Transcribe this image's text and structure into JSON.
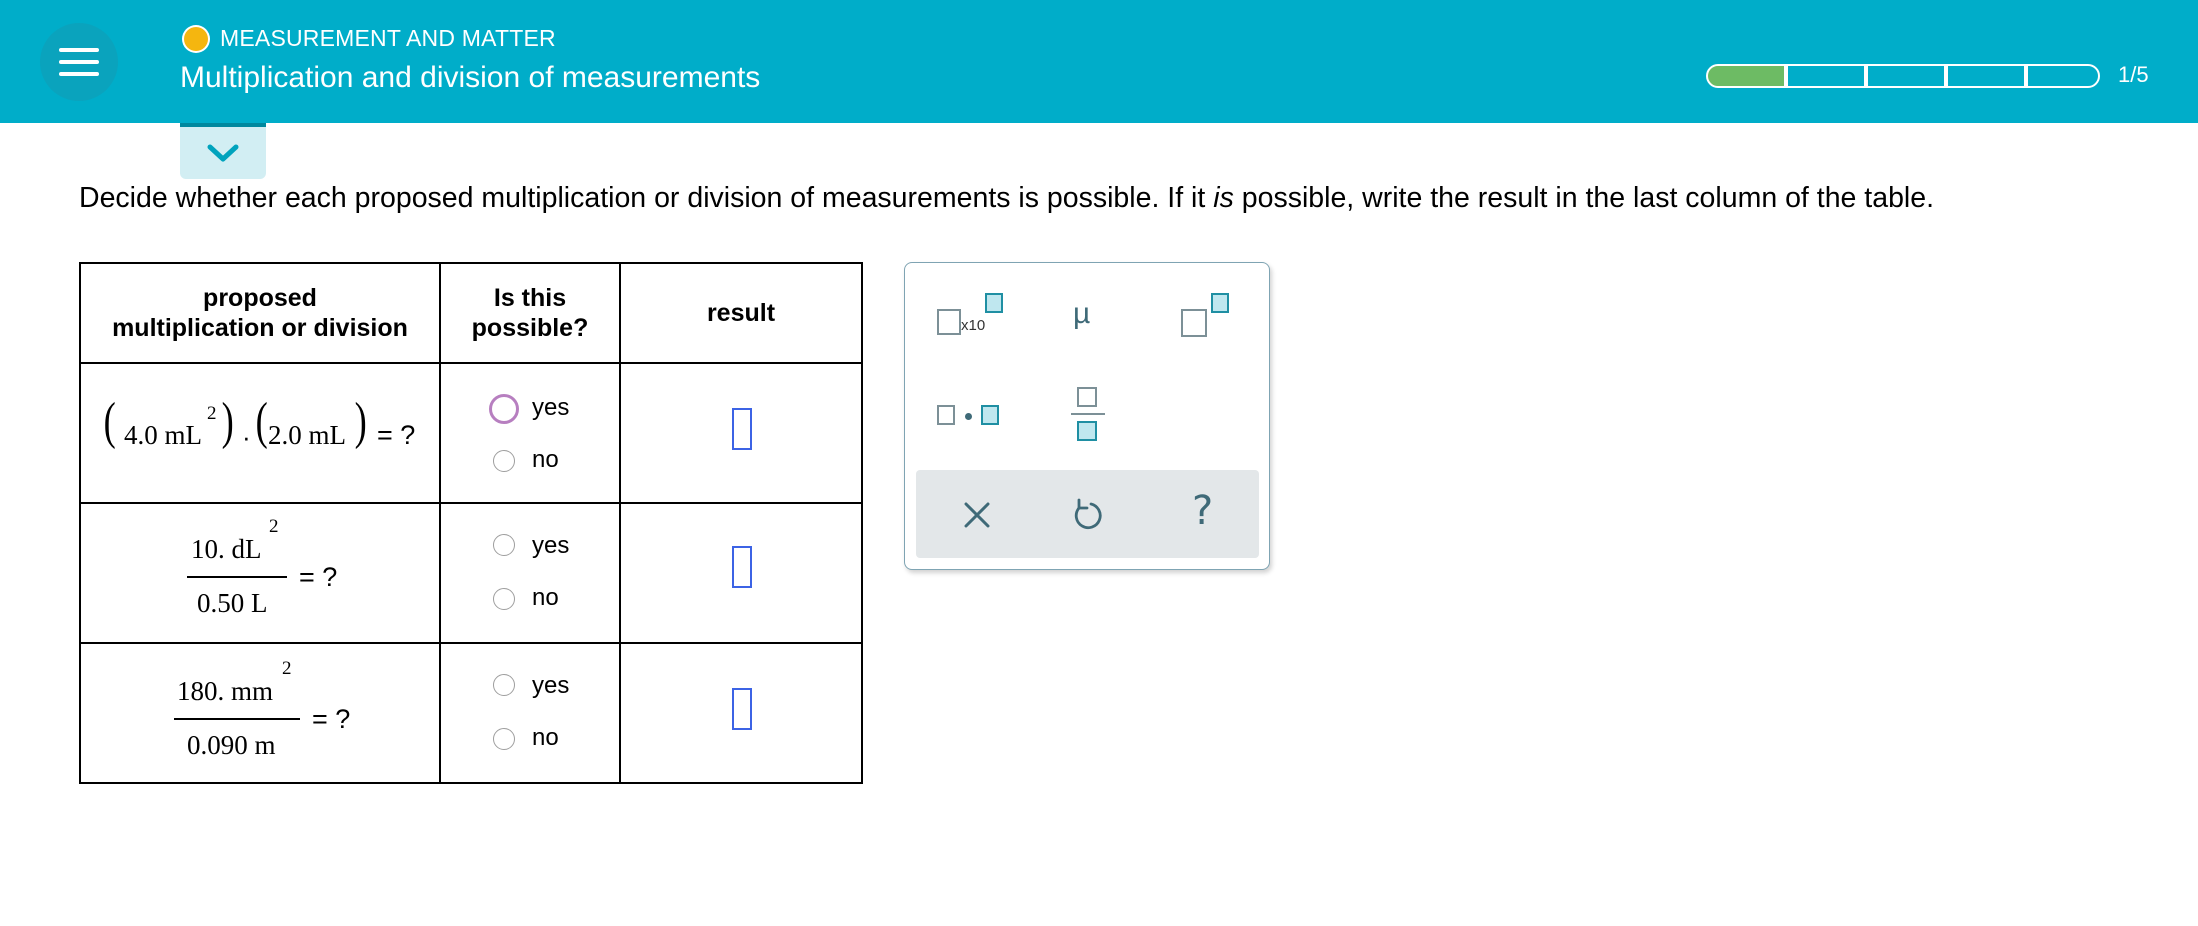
{
  "header": {
    "topic": "MEASUREMENT AND MATTER",
    "title": "Multiplication and division of measurements",
    "progress": {
      "completed": 1,
      "total": 5,
      "label": "1/5",
      "color_done": "#6dbb64"
    }
  },
  "colors": {
    "header_bg": "#00adc9",
    "accent": "#3c63e5",
    "radio_focus": "#b77fc0"
  },
  "prompt": {
    "before": "Decide whether each proposed multiplication or division of measurements is possible. If it ",
    "emphasis": "is",
    "after": " possible, write the result in the last column of the table."
  },
  "table": {
    "headers": {
      "col1_line1": "proposed",
      "col1_line2": "multiplication or division",
      "col2_line1": "Is this",
      "col2_line2": "possible?",
      "col3": "result"
    },
    "rows": [
      {
        "factor1": "4.0 mL",
        "exp1": "2",
        "dot": "·",
        "factor2": "2.0 mL",
        "equals": "= ?",
        "yes": "yes",
        "no": "no"
      },
      {
        "numerator": "10. dL",
        "num_exp": "2",
        "denominator": "0.50 L",
        "equals": "= ?",
        "yes": "yes",
        "no": "no"
      },
      {
        "numerator": "180. mm",
        "num_exp": "2",
        "denominator": "0.090 m",
        "equals": "= ?",
        "yes": "yes",
        "no": "no"
      }
    ]
  },
  "keypad": {
    "x10_label": "x10",
    "mu_label": "µ",
    "clear_icon": "×",
    "undo_icon": "undo-icon",
    "help_label": "?"
  }
}
